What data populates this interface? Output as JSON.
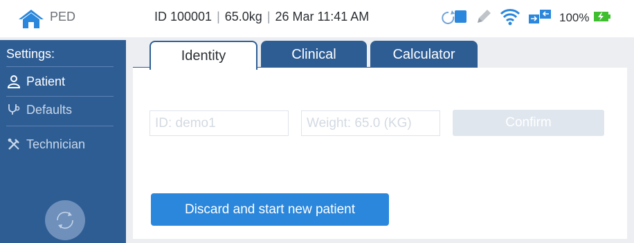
{
  "status_bar": {
    "mode": "PED",
    "patient_id": "ID 100001",
    "weight": "65.0kg",
    "datetime": "26 Mar  11:41 AM",
    "battery": "100%",
    "icons": [
      "home-icon",
      "sync-icon",
      "pencil-icon",
      "wifi-icon",
      "transfer-icon",
      "battery-charging-icon"
    ]
  },
  "sidebar": {
    "title": "Settings:",
    "items": [
      {
        "label": "Patient",
        "icon": "person-icon"
      },
      {
        "label": "Defaults",
        "icon": "stethoscope-icon"
      },
      {
        "label": "Technician",
        "icon": "tools-icon"
      }
    ]
  },
  "tabs": [
    {
      "label": "Identity",
      "active": true
    },
    {
      "label": "Clinical",
      "active": false
    },
    {
      "label": "Calculator",
      "active": false
    }
  ],
  "identity": {
    "id_placeholder": "ID:  demo1",
    "weight_placeholder": "Weight:  65.0 (KG)",
    "confirm_label": "Confirm",
    "discard_label": "Discard and start new patient"
  },
  "colors": {
    "primary": "#2e5d94",
    "button": "#2b87dc",
    "charging": "#3fbf2f"
  }
}
